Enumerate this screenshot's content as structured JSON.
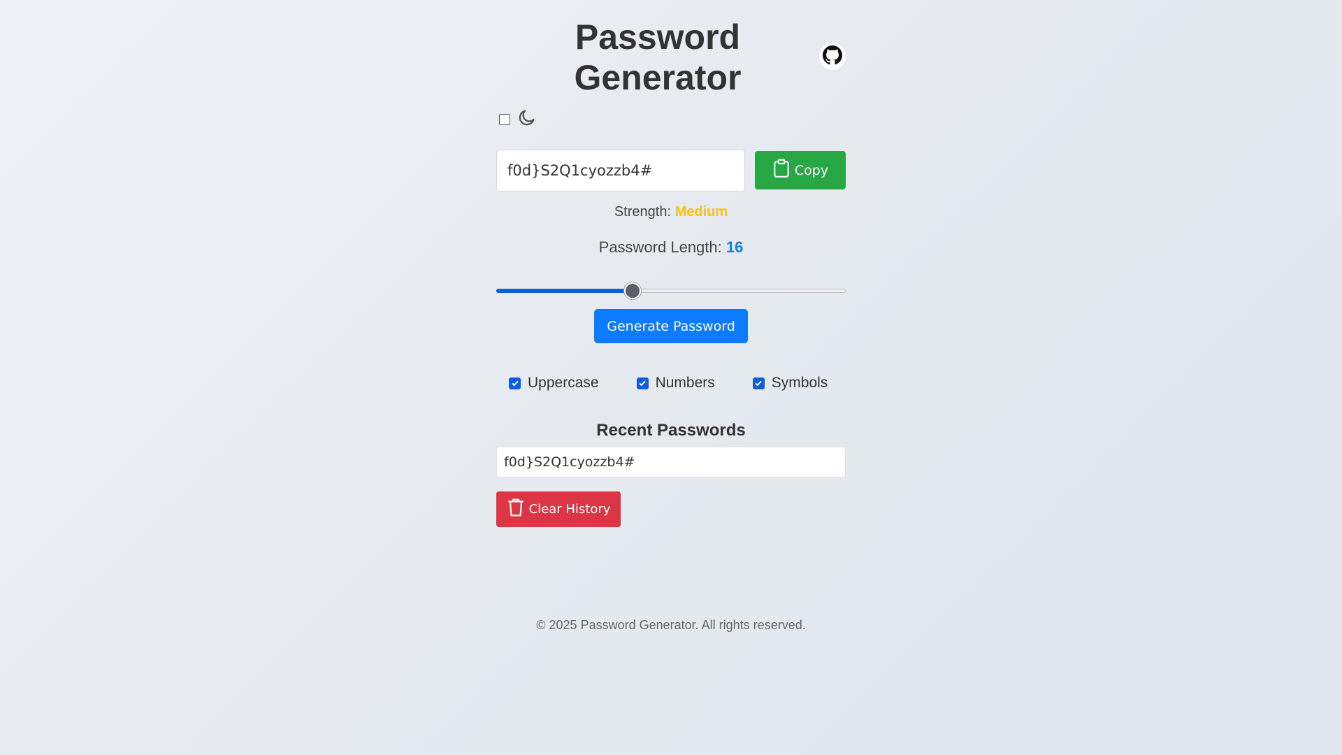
{
  "header": {
    "title": "Password\nGenerator",
    "github_icon": "github-icon"
  },
  "theme": {
    "dark_mode_checked": false,
    "icon": "moon-icon"
  },
  "password": {
    "value": "f0d}S2Q1cyozzb4#",
    "copy_label": "Copy",
    "copy_icon": "clipboard-icon"
  },
  "strength": {
    "label": "Strength:",
    "value": "Medium",
    "color": "#ffc107"
  },
  "length": {
    "label": "Password Length:",
    "value": "16",
    "slider_value": 16,
    "slider_min": 6,
    "slider_max": 32
  },
  "generate": {
    "label": "Generate Password"
  },
  "options": [
    {
      "label": "Uppercase",
      "checked": true
    },
    {
      "label": "Numbers",
      "checked": true
    },
    {
      "label": "Symbols",
      "checked": true
    }
  ],
  "recent": {
    "title": "Recent Passwords",
    "items": [
      "f0d}S2Q1cyozzb4#"
    ],
    "clear_label": "Clear History",
    "clear_icon": "trash-icon"
  },
  "footer": {
    "text": "© 2025 Password Generator. All rights reserved."
  },
  "colors": {
    "copy": "#28a745",
    "generate": "#0d7bff",
    "clear": "#dc3545",
    "accent": "#1a7fd4"
  }
}
